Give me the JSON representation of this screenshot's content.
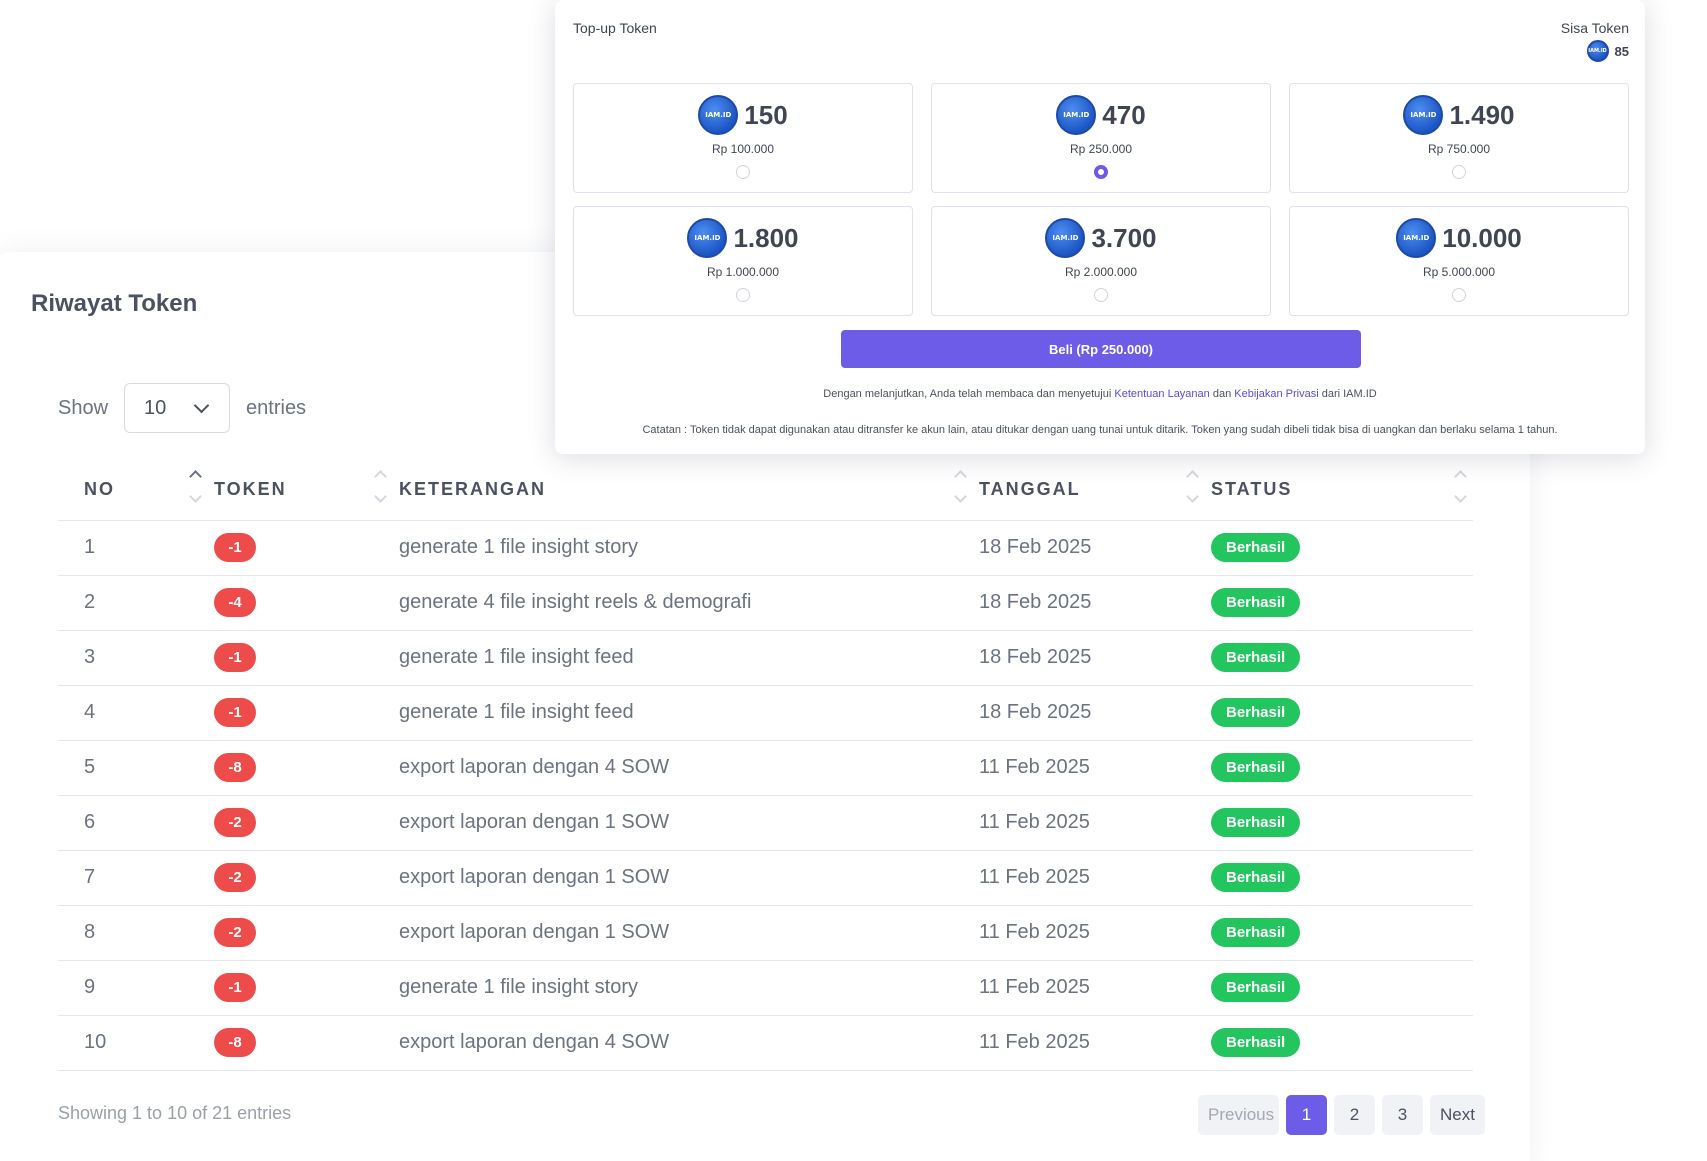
{
  "history": {
    "title": "Riwayat Token",
    "show_label": "Show",
    "entries_label": "entries",
    "page_length": "10",
    "columns": [
      "NO",
      "TOKEN",
      "KETERANGAN",
      "TANGGAL",
      "STATUS"
    ],
    "rows": [
      {
        "no": "1",
        "token": "-1",
        "desc": "generate 1 file insight story",
        "date": "18 Feb 2025",
        "status": "Berhasil"
      },
      {
        "no": "2",
        "token": "-4",
        "desc": "generate 4 file insight reels & demografi",
        "date": "18 Feb 2025",
        "status": "Berhasil"
      },
      {
        "no": "3",
        "token": "-1",
        "desc": "generate 1 file insight feed",
        "date": "18 Feb 2025",
        "status": "Berhasil"
      },
      {
        "no": "4",
        "token": "-1",
        "desc": "generate 1 file insight feed",
        "date": "18 Feb 2025",
        "status": "Berhasil"
      },
      {
        "no": "5",
        "token": "-8",
        "desc": "export laporan dengan 4 SOW",
        "date": "11 Feb 2025",
        "status": "Berhasil"
      },
      {
        "no": "6",
        "token": "-2",
        "desc": "export laporan dengan 1 SOW",
        "date": "11 Feb 2025",
        "status": "Berhasil"
      },
      {
        "no": "7",
        "token": "-2",
        "desc": "export laporan dengan 1 SOW",
        "date": "11 Feb 2025",
        "status": "Berhasil"
      },
      {
        "no": "8",
        "token": "-2",
        "desc": "export laporan dengan 1 SOW",
        "date": "11 Feb 2025",
        "status": "Berhasil"
      },
      {
        "no": "9",
        "token": "-1",
        "desc": "generate 1 file insight story",
        "date": "11 Feb 2025",
        "status": "Berhasil"
      },
      {
        "no": "10",
        "token": "-8",
        "desc": "export laporan dengan 4 SOW",
        "date": "11 Feb 2025",
        "status": "Berhasil"
      }
    ],
    "info": "Showing 1 to 10 of 21 entries",
    "pagination": {
      "previous": "Previous",
      "pages": [
        "1",
        "2",
        "3"
      ],
      "current": "1",
      "next": "Next"
    }
  },
  "topup": {
    "title": "Top-up Token",
    "remaining_label": "Sisa Token",
    "remaining_value": "85",
    "coin_text": "IAM.ID",
    "packages": [
      {
        "amount": "150",
        "price": "Rp 100.000",
        "selected": false
      },
      {
        "amount": "470",
        "price": "Rp 250.000",
        "selected": true
      },
      {
        "amount": "1.490",
        "price": "Rp 750.000",
        "selected": false
      },
      {
        "amount": "1.800",
        "price": "Rp 1.000.000",
        "selected": false
      },
      {
        "amount": "3.700",
        "price": "Rp 2.000.000",
        "selected": false
      },
      {
        "amount": "10.000",
        "price": "Rp 5.000.000",
        "selected": false
      }
    ],
    "buy_label": "Beli (Rp 250.000)",
    "consent": {
      "prefix": "Dengan melanjutkan, Anda telah membaca dan menyetujui",
      "terms_link": "Ketentuan Layanan",
      "and": "dan",
      "privacy_link": "Kebijakan Privasi",
      "suffix": "dari IAM.ID"
    },
    "note": "Catatan : Token tidak dapat digunakan atau ditransfer ke akun lain, atau ditukar dengan uang tunai untuk ditarik. Token yang sudah dibeli tidak bisa di uangkan dan berlaku selama 1 tahun."
  },
  "colors": {
    "accent": "#6d5ce7",
    "danger": "#ee4b4b",
    "success": "#22c55e"
  }
}
